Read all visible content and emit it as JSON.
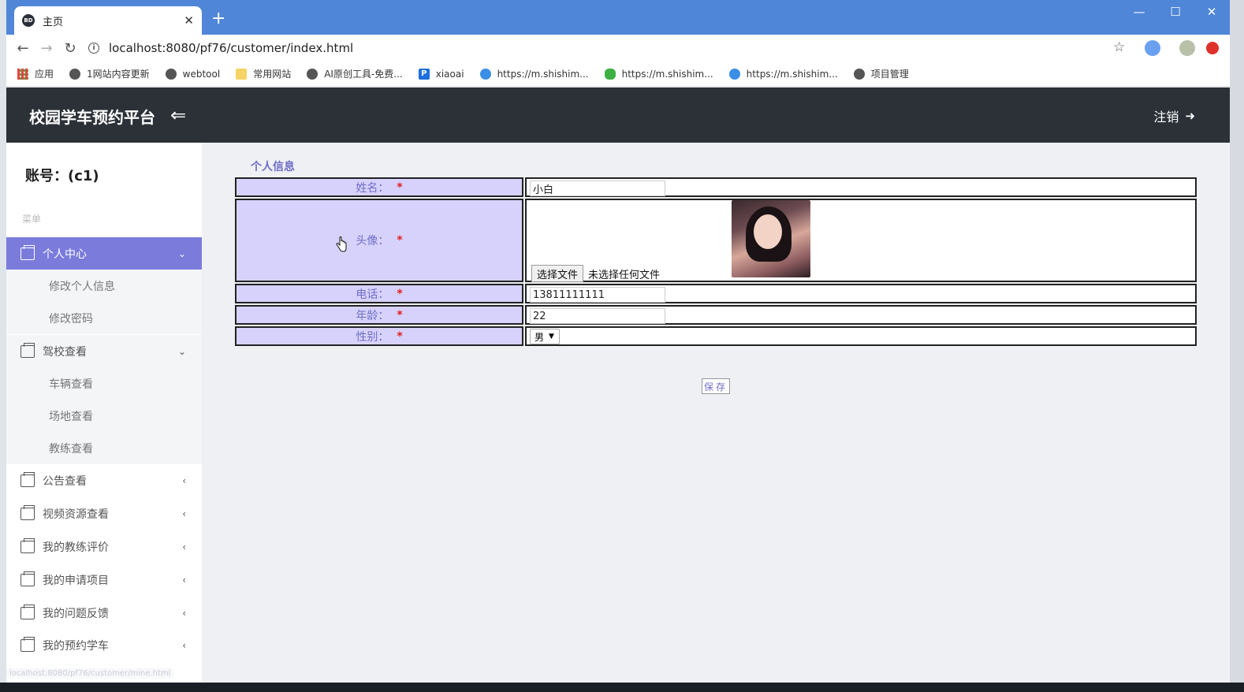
{
  "browser": {
    "tab_title": "主页",
    "url": "localhost:8080/pf76/customer/index.html",
    "bookmarks": [
      {
        "label": "应用",
        "icon": "apps-grid-icon"
      },
      {
        "label": "1网站内容更新",
        "icon": "globe-icon"
      },
      {
        "label": "webtool",
        "icon": "globe-icon"
      },
      {
        "label": "常用网站",
        "icon": "folder-icon"
      },
      {
        "label": "AI原创工具-免费...",
        "icon": "globe-icon"
      },
      {
        "label": "xiaoai",
        "icon": "p-logo-icon"
      },
      {
        "label": "https://m.shishim...",
        "icon": "blue-c-icon"
      },
      {
        "label": "https://m.shishim...",
        "icon": "wechat-icon"
      },
      {
        "label": "https://m.shishim...",
        "icon": "blue-c-icon"
      },
      {
        "label": "项目管理",
        "icon": "globe-icon"
      }
    ]
  },
  "app": {
    "title": "校园学车预约平台",
    "logout_label": "注销"
  },
  "sidebar": {
    "account": "账号：(c1)",
    "menu_label": "菜单",
    "groups": [
      {
        "label": "个人中心",
        "expanded": true,
        "active": true,
        "children": [
          "修改个人信息",
          "修改密码"
        ]
      },
      {
        "label": "驾校查看",
        "expanded": true,
        "children": [
          "车辆查看",
          "场地查看",
          "教练查看"
        ]
      },
      {
        "label": "公告查看",
        "expanded": false
      },
      {
        "label": "视频资源查看",
        "expanded": false
      },
      {
        "label": "我的教练评价",
        "expanded": false
      },
      {
        "label": "我的申请项目",
        "expanded": false
      },
      {
        "label": "我的问题反馈",
        "expanded": false
      },
      {
        "label": "我的预约学车",
        "expanded": false
      }
    ]
  },
  "form": {
    "section_title": "个人信息",
    "required_mark": "*",
    "fields": {
      "name": {
        "label": "姓名：",
        "value": "小白"
      },
      "avatar": {
        "label": "头像：",
        "file_button": "选择文件",
        "file_status": "未选择任何文件"
      },
      "phone": {
        "label": "电话：",
        "value": "13811111111"
      },
      "age": {
        "label": "年龄：",
        "value": "22"
      },
      "gender": {
        "label": "性别：",
        "value": "男"
      }
    },
    "save_label": "保存"
  },
  "status_bar": {
    "hover_url": "localhost:8080/pf76/customer/mine.html"
  },
  "colors": {
    "browser_bar": "#4f86d8",
    "header_bg": "#2c3138",
    "accent": "#7b7bdc",
    "label_bg": "#d7d2fb",
    "label_text": "#6f6fc8",
    "required": "#e02020"
  }
}
